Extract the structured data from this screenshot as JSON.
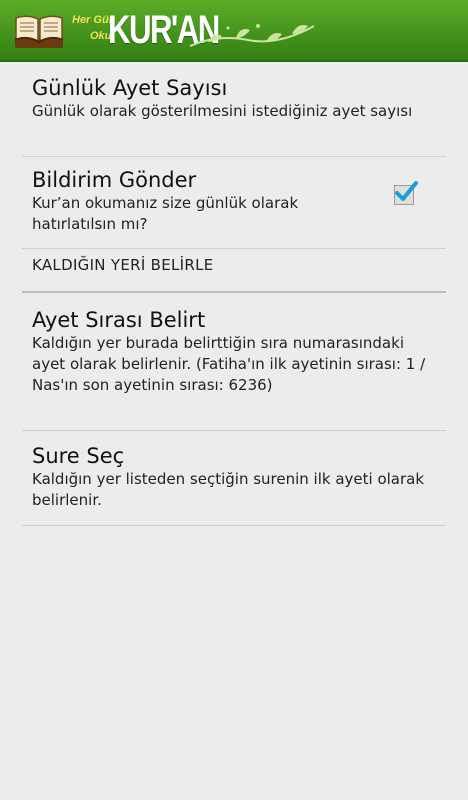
{
  "header": {
    "logo_small_1": "Her Gün",
    "logo_small_2": "Oku",
    "logo_title": "KUR'AN",
    "accent_color": "#4a9c20"
  },
  "settings": {
    "daily_verse_count": {
      "title": "Günlük Ayet Sayısı",
      "summary": "Günlük olarak gösterilmesini istediğiniz ayet sayısı"
    },
    "send_notification": {
      "title": "Bildirim Gönder",
      "summary": "Kur’an okumanız size günlük olarak hatırlatılsın mı?",
      "checked": true
    },
    "category_label": "KALDIĞIN YERİ BELİRLE",
    "verse_order": {
      "title": "Ayet Sırası Belirt",
      "summary": "Kaldığın yer burada belirttiğin sıra numarasındaki ayet olarak belirlenir. (Fatiha'ın ilk ayetinin sırası: 1 / Nas'ın son ayetinin sırası: 6236)"
    },
    "select_sura": {
      "title": "Sure Seç",
      "summary": "Kaldığın yer listeden seçtiğin surenin ilk ayeti olarak belirlenir."
    }
  },
  "icons": {
    "book": "open-book-icon",
    "checkbox": "checkbox-checked-icon"
  }
}
